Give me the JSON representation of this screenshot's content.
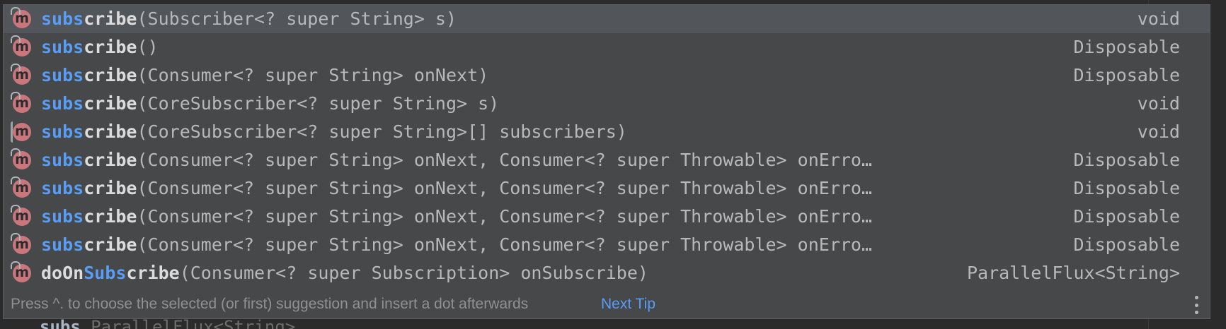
{
  "popup": {
    "items": [
      {
        "pre": "",
        "hl": "subs",
        "rest": "cribe",
        "params": "(Subscriber<? super String> s)",
        "ret": "void",
        "icon": "method-icon",
        "locked": false,
        "selected": true
      },
      {
        "pre": "",
        "hl": "subs",
        "rest": "cribe",
        "params": "()",
        "ret": "Disposable",
        "icon": "method-icon",
        "locked": false,
        "selected": false
      },
      {
        "pre": "",
        "hl": "subs",
        "rest": "cribe",
        "params": "(Consumer<? super String> onNext)",
        "ret": "Disposable",
        "icon": "method-icon",
        "locked": false,
        "selected": false
      },
      {
        "pre": "",
        "hl": "subs",
        "rest": "cribe",
        "params": "(CoreSubscriber<? super String> s)",
        "ret": "void",
        "icon": "method-icon",
        "locked": false,
        "selected": false
      },
      {
        "pre": "",
        "hl": "subs",
        "rest": "cribe",
        "params": "(CoreSubscriber<? super String>[] subscribers)",
        "ret": "void",
        "icon": "method-icon",
        "locked": true,
        "selected": false
      },
      {
        "pre": "",
        "hl": "subs",
        "rest": "cribe",
        "params": "(Consumer<? super String> onNext, Consumer<? super Throwable> onErro…",
        "ret": "Disposable",
        "icon": "method-icon",
        "locked": false,
        "selected": false
      },
      {
        "pre": "",
        "hl": "subs",
        "rest": "cribe",
        "params": "(Consumer<? super String> onNext, Consumer<? super Throwable> onErro…",
        "ret": "Disposable",
        "icon": "method-icon",
        "locked": false,
        "selected": false
      },
      {
        "pre": "",
        "hl": "subs",
        "rest": "cribe",
        "params": "(Consumer<? super String> onNext, Consumer<? super Throwable> onErro…",
        "ret": "Disposable",
        "icon": "method-icon",
        "locked": false,
        "selected": false
      },
      {
        "pre": "",
        "hl": "subs",
        "rest": "cribe",
        "params": "(Consumer<? super String> onNext, Consumer<? super Throwable> onErro…",
        "ret": "Disposable",
        "icon": "method-icon",
        "locked": false,
        "selected": false
      },
      {
        "pre": "doOn",
        "hl": "Subs",
        "rest": "cribe",
        "params": "(Consumer<? super Subscription> onSubscribe)",
        "ret": "ParallelFlux<String>",
        "icon": "method-icon",
        "locked": false,
        "selected": false
      }
    ],
    "footer": {
      "text": "Press ^. to choose the selected (or first) suggestion and insert a dot afterwards",
      "link": "Next Tip",
      "menu_icon": "more-vertical-icon"
    }
  },
  "editor": {
    "typed": "subs",
    "hint": " ParallelFlux<String>"
  },
  "colors": {
    "popup_bg": "#46484a",
    "selected_bg": "#52565a",
    "match_highlight": "#589df6",
    "method_icon": "#c9767d",
    "link": "#589df6"
  }
}
